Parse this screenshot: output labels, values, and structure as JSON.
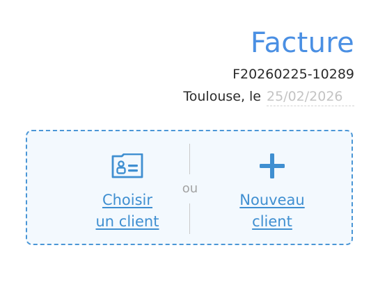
{
  "invoice": {
    "title": "Facture",
    "number": "F20260225-10289",
    "place_label": "Toulouse, le",
    "date_placeholder": "25/02/2026"
  },
  "client_picker": {
    "choose_line1": "Choisir",
    "choose_line2": "un client",
    "separator": "ou",
    "new_line1": "Nouveau",
    "new_line2": "client",
    "choose_icon": "contact-card-icon",
    "new_icon": "plus-icon",
    "accent_color": "#3f8fd1"
  }
}
